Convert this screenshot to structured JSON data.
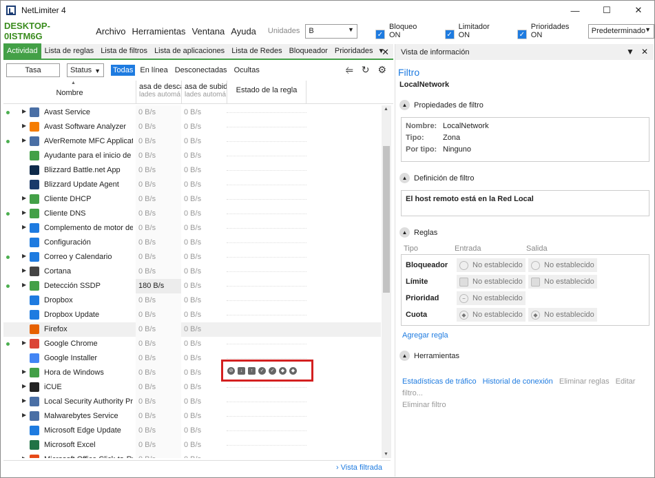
{
  "window": {
    "title": "NetLimiter 4",
    "controls": [
      "—",
      "☐",
      "✕"
    ]
  },
  "toolbar": {
    "host": "DESKTOP-0ISTM6G",
    "menu": [
      "Archivo",
      "Herramientas",
      "Ventana",
      "Ayuda"
    ],
    "units_label": "Unidades",
    "units_value": "B",
    "block_label": "Bloqueo ON",
    "limiter_label": "Limitador ON",
    "priorities_label": "Prioridades ON",
    "preset_value": "Predeterminado"
  },
  "left_tabs": [
    "Actividad",
    "Lista de reglas",
    "Lista de filtros",
    "Lista de aplicaciones",
    "Lista de Redes",
    "Bloqueador",
    "Prioridades"
  ],
  "filterbar": {
    "search_value": "Tasa",
    "status_value": "Status",
    "views": [
      "Todas",
      "En línea",
      "Desconectadas",
      "Ocultas"
    ]
  },
  "grid_head": {
    "name": "Nombre",
    "download": "asa de descar",
    "download_sub": "lades automá",
    "upload": "asa de subid",
    "upload_sub": "lades automá",
    "rule_state": "Estado de la regla"
  },
  "rows": [
    {
      "name": "Avast Service",
      "dl": "0 B/s",
      "ul": "0 B/s",
      "online": true,
      "expand": true,
      "icon_color": "#4a6fa5"
    },
    {
      "name": "Avast Software Analyzer",
      "dl": "0 B/s",
      "ul": "0 B/s",
      "online": false,
      "expand": true,
      "icon_color": "#f57c00"
    },
    {
      "name": "AVerRemote MFC Applicati",
      "dl": "0 B/s",
      "ul": "0 B/s",
      "online": true,
      "expand": true,
      "icon_color": "#4a6fa5"
    },
    {
      "name": "Ayudante para el inicio de s",
      "dl": "0 B/s",
      "ul": "0 B/s",
      "online": false,
      "expand": false,
      "icon_color": "#43a047"
    },
    {
      "name": "Blizzard Battle.net App",
      "dl": "0 B/s",
      "ul": "0 B/s",
      "online": false,
      "expand": false,
      "icon_color": "#0e2a4a"
    },
    {
      "name": "Blizzard Update Agent",
      "dl": "0 B/s",
      "ul": "0 B/s",
      "online": false,
      "expand": false,
      "icon_color": "#1a3a6a"
    },
    {
      "name": "Cliente DHCP",
      "dl": "0 B/s",
      "ul": "0 B/s",
      "online": false,
      "expand": true,
      "icon_color": "#43a047"
    },
    {
      "name": "Cliente DNS",
      "dl": "0 B/s",
      "ul": "0 B/s",
      "online": true,
      "expand": true,
      "icon_color": "#43a047"
    },
    {
      "name": "Complemento de motor del",
      "dl": "0 B/s",
      "ul": "0 B/s",
      "online": false,
      "expand": true,
      "icon_color": "#1e7be0"
    },
    {
      "name": "Configuración",
      "dl": "0 B/s",
      "ul": "0 B/s",
      "online": false,
      "expand": false,
      "icon_color": "#1e7be0"
    },
    {
      "name": "Correo y Calendario",
      "dl": "0 B/s",
      "ul": "0 B/s",
      "online": true,
      "expand": true,
      "icon_color": "#1e7be0"
    },
    {
      "name": "Cortana",
      "dl": "0 B/s",
      "ul": "0 B/s",
      "online": false,
      "expand": true,
      "icon_color": "#444"
    },
    {
      "name": "Detección SSDP",
      "dl": "180 B/s",
      "ul": "0 B/s",
      "online": true,
      "expand": true,
      "icon_color": "#43a047",
      "hot": true
    },
    {
      "name": "Dropbox",
      "dl": "0 B/s",
      "ul": "0 B/s",
      "online": false,
      "expand": false,
      "icon_color": "#1e7be0"
    },
    {
      "name": "Dropbox Update",
      "dl": "0 B/s",
      "ul": "0 B/s",
      "online": false,
      "expand": false,
      "icon_color": "#1e7be0"
    },
    {
      "name": "Firefox",
      "dl": "0 B/s",
      "ul": "0 B/s",
      "online": false,
      "expand": false,
      "icon_color": "#e66000",
      "selected": true
    },
    {
      "name": "Google Chrome",
      "dl": "0 B/s",
      "ul": "0 B/s",
      "online": true,
      "expand": true,
      "icon_color": "#db4437"
    },
    {
      "name": "Google Installer",
      "dl": "0 B/s",
      "ul": "0 B/s",
      "online": false,
      "expand": false,
      "icon_color": "#4285f4"
    },
    {
      "name": "Hora de Windows",
      "dl": "0 B/s",
      "ul": "0 B/s",
      "online": false,
      "expand": true,
      "icon_color": "#43a047"
    },
    {
      "name": "iCUE",
      "dl": "0 B/s",
      "ul": "0 B/s",
      "online": false,
      "expand": true,
      "icon_color": "#222"
    },
    {
      "name": "Local Security Authority Pro",
      "dl": "0 B/s",
      "ul": "0 B/s",
      "online": false,
      "expand": true,
      "icon_color": "#4a6fa5"
    },
    {
      "name": "Malwarebytes Service",
      "dl": "0 B/s",
      "ul": "0 B/s",
      "online": false,
      "expand": true,
      "icon_color": "#4a6fa5"
    },
    {
      "name": "Microsoft Edge Update",
      "dl": "0 B/s",
      "ul": "0 B/s",
      "online": false,
      "expand": false,
      "icon_color": "#1e7be0"
    },
    {
      "name": "Microsoft Excel",
      "dl": "0 B/s",
      "ul": "0 B/s",
      "online": false,
      "expand": false,
      "icon_color": "#217346"
    },
    {
      "name": "Microsoft Office Click-to-Ru",
      "dl": "0 B/s",
      "ul": "0 B/s",
      "online": false,
      "expand": true,
      "icon_color": "#e64a19"
    }
  ],
  "left_footer": {
    "link": "› Vista filtrada"
  },
  "right": {
    "header": "Vista de información",
    "title": "Filtro",
    "subtitle": "LocalNetwork",
    "sect_props": "Propiedades de filtro",
    "props": [
      {
        "k": "Nombre:",
        "v": "LocalNetwork"
      },
      {
        "k": "Tipo:",
        "v": "Zona"
      },
      {
        "k": "Por tipo:",
        "v": "Ninguno"
      }
    ],
    "sect_def": "Definición de filtro",
    "definition": "El host remoto está en la Red Local",
    "sect_rules": "Reglas",
    "rules_cols": [
      "Tipo",
      "Entrada",
      "Salida"
    ],
    "rules": [
      {
        "k": "Bloqueador",
        "in": "No establecido",
        "out": "No establecido",
        "shape": "circle"
      },
      {
        "k": "Límite",
        "in": "No establecido",
        "out": "No establecido",
        "shape": "square"
      },
      {
        "k": "Prioridad",
        "in": "No establecido",
        "out": "",
        "shape": "minus"
      },
      {
        "k": "Cuota",
        "in": "No establecido",
        "out": "No establecido",
        "shape": "shield"
      }
    ],
    "add_rule": "Agregar regla",
    "sect_tools": "Herramientas",
    "tools_active": [
      "Estadísticas de tráfico",
      "Historial de conexión"
    ],
    "tools_muted": [
      "Eliminar reglas",
      "Editar filtro...",
      "Eliminar filtro"
    ]
  },
  "colors": {
    "accent_green": "#43a047",
    "accent_blue": "#1e7be0",
    "highlight_red": "#d32020"
  }
}
